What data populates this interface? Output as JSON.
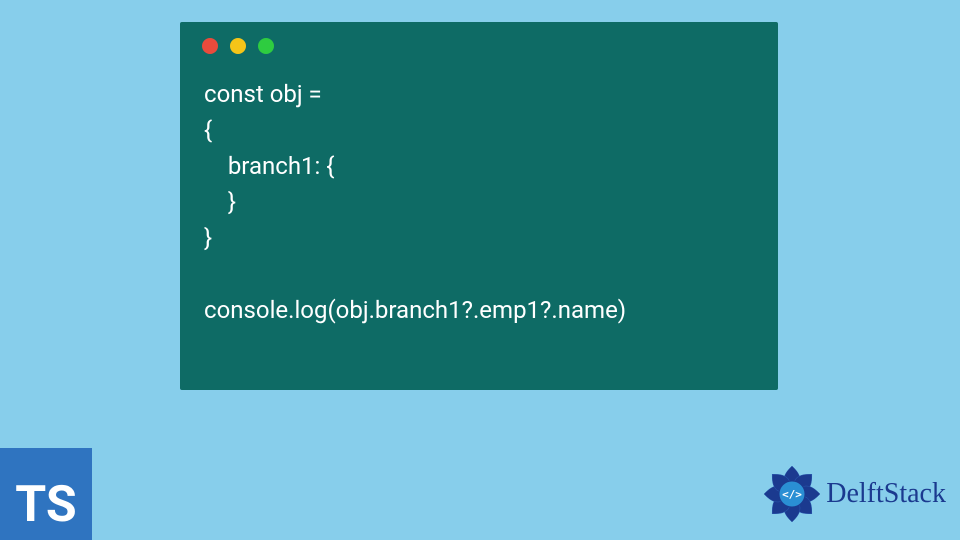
{
  "code": {
    "line1": "const obj =",
    "line2": "{",
    "line3": "    branch1: {",
    "line4": "    }",
    "line5": "}",
    "line6": "",
    "line7": "console.log(obj.branch1?.emp1?.name)"
  },
  "badges": {
    "ts": "TS",
    "delft": "DelftStack"
  },
  "colors": {
    "background": "#87ceeb",
    "window": "#0e6b65",
    "dot_red": "#e94b3c",
    "dot_yellow": "#f5c518",
    "dot_green": "#2ecc40",
    "ts_bg": "#2f74c0",
    "delft_text": "#1b3a8f"
  }
}
